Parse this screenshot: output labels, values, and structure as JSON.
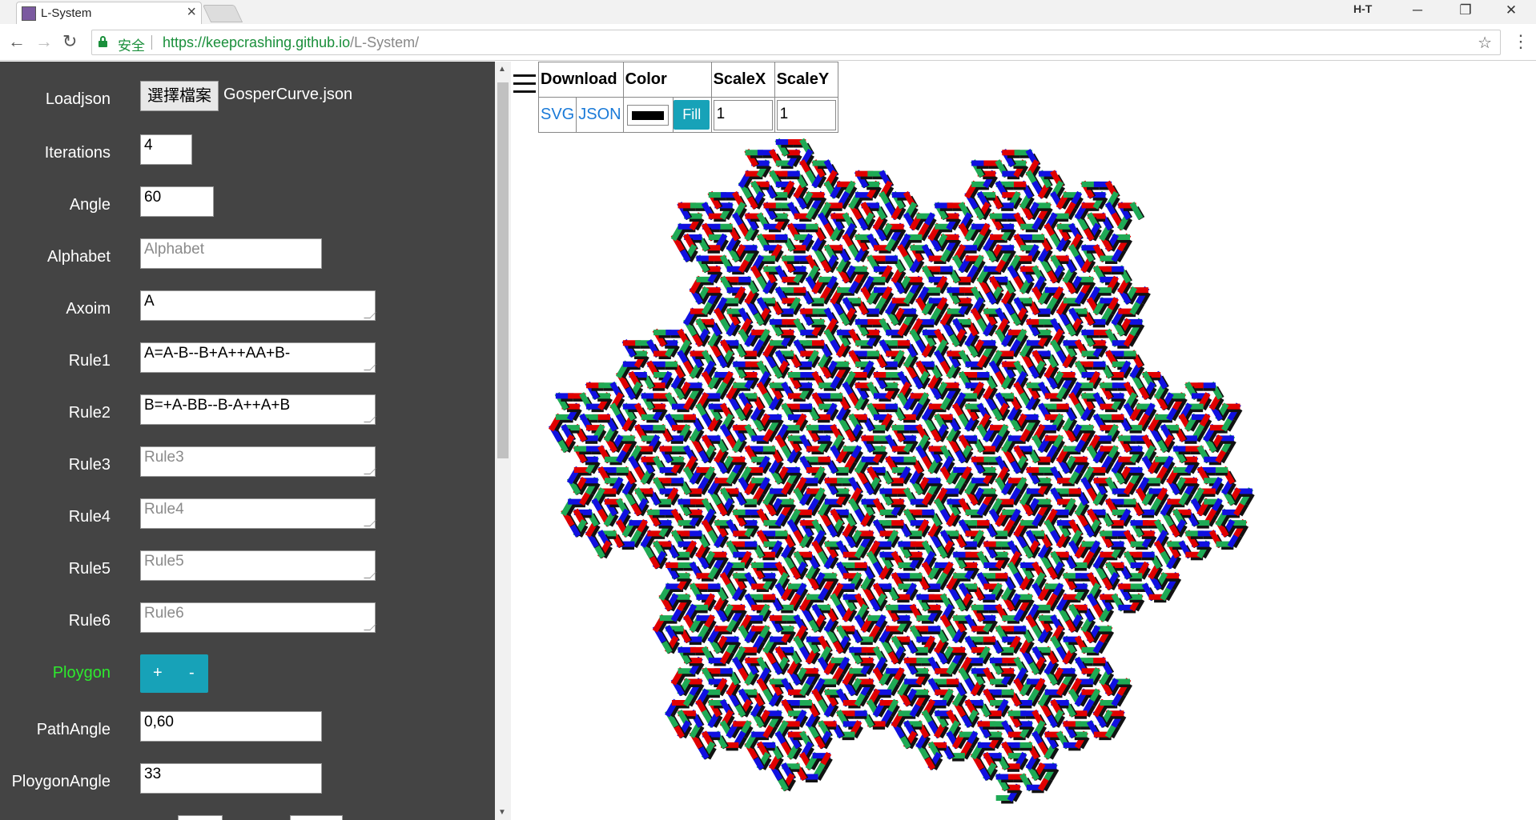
{
  "browser": {
    "tab_title": "L-System",
    "tab_close": "×",
    "win_label": "H-T",
    "secure_label": "安全",
    "url_host": "https://keepcrashing.github.io",
    "url_path": "/L-System/"
  },
  "panel": {
    "loadjson": {
      "label": "Loadjson",
      "button": "選擇檔案",
      "file": "GosperCurve.json"
    },
    "iterations": {
      "label": "Iterations",
      "value": "4"
    },
    "angle": {
      "label": "Angle",
      "value": "60"
    },
    "alphabet": {
      "label": "Alphabet",
      "value": "",
      "placeholder": "Alphabet"
    },
    "axiom": {
      "label": "Axoim",
      "value": "A"
    },
    "rule1": {
      "label": "Rule1",
      "value": "A=A-B--B+A++AA+B-"
    },
    "rule2": {
      "label": "Rule2",
      "value": "B=+A-BB--B-A++A+B"
    },
    "rule3": {
      "label": "Rule3",
      "value": "",
      "placeholder": "Rule3"
    },
    "rule4": {
      "label": "Rule4",
      "value": "",
      "placeholder": "Rule4"
    },
    "rule5": {
      "label": "Rule5",
      "value": "",
      "placeholder": "Rule5"
    },
    "rule6": {
      "label": "Rule6",
      "value": "",
      "placeholder": "Rule6"
    },
    "ploygon": {
      "label": "Ploygon",
      "plus": "+",
      "minus": "-"
    },
    "pathangle": {
      "label": "PathAngle",
      "value": "0,60"
    },
    "ploygonangle": {
      "label": "PloygonAngle",
      "value": "33"
    }
  },
  "toolbar": {
    "headers": [
      "Download",
      "Color",
      "ScaleX",
      "ScaleY"
    ],
    "svg_link": "SVG",
    "json_link": "JSON",
    "fill_button": "Fill",
    "scale_x": "1",
    "scale_y": "1",
    "color_value": "#000000"
  },
  "render": {
    "colors": {
      "red": "#e00000",
      "green": "#1faa55",
      "blue": "#1010e0",
      "shadow": "#111111"
    }
  }
}
